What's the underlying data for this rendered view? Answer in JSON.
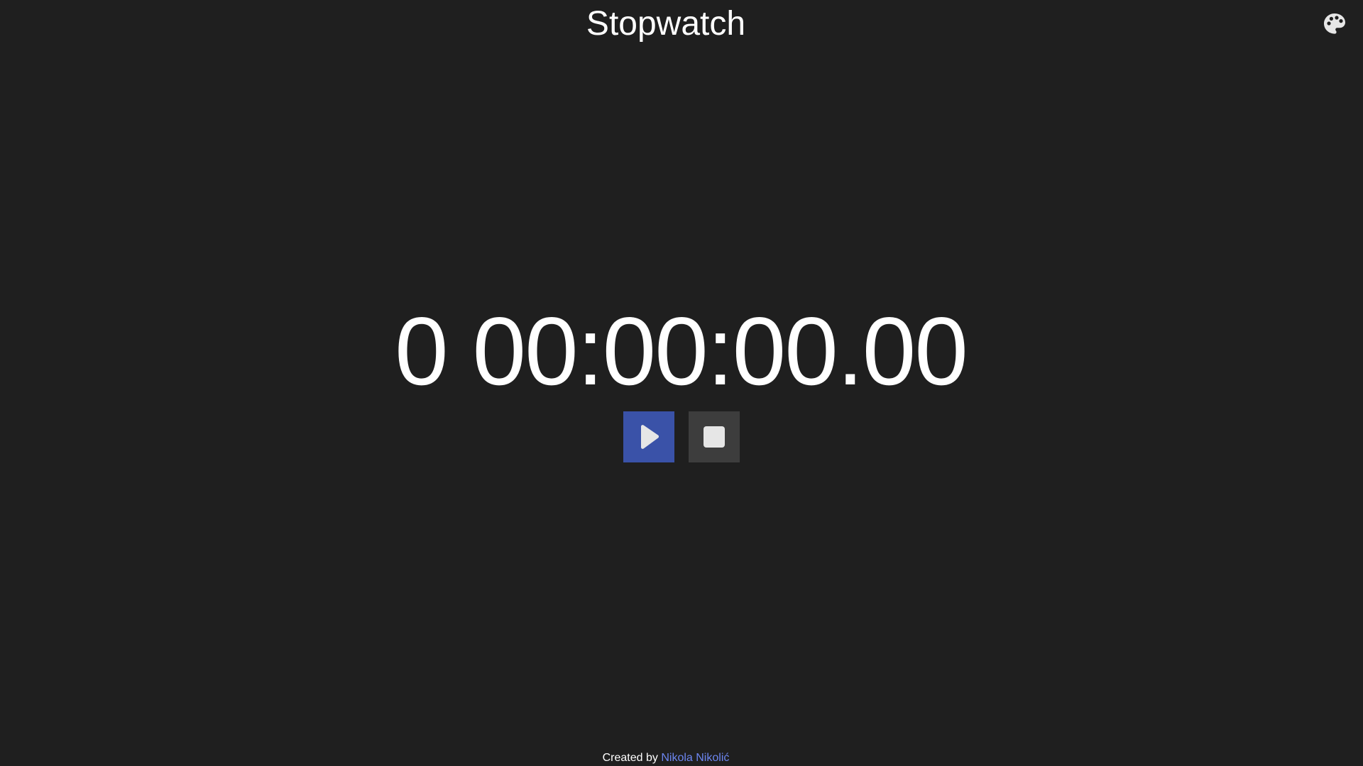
{
  "app": {
    "title": "Stopwatch"
  },
  "header": {
    "theme_icon": "palette-icon"
  },
  "timer": {
    "display": "0 00:00:00.00"
  },
  "controls": {
    "play_icon": "play-icon",
    "stop_icon": "stop-icon"
  },
  "footer": {
    "created_by_label": "Created by",
    "author_name": "Nikola Nikolić"
  },
  "colors": {
    "background": "#1f1f1f",
    "text": "#ffffff",
    "play_button": "#3a52a8",
    "stop_button": "#3d3d3d",
    "link": "#6c86f0",
    "icon": "#e6e6e6"
  }
}
